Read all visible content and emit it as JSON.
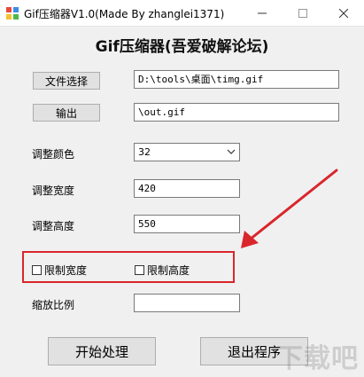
{
  "window": {
    "title": "Gif压缩器V1.0(Made By zhanglei1371)"
  },
  "heading": "Gif压缩器(吾爱破解论坛)",
  "file_select": {
    "button_label": "文件选择",
    "path_value": "D:\\tools\\桌面\\timg.gif"
  },
  "output": {
    "button_label": "输出",
    "value": "\\out.gif"
  },
  "color": {
    "label": "调整颜色",
    "selected": "32"
  },
  "width": {
    "label": "调整宽度",
    "value": "420"
  },
  "height": {
    "label": "调整高度",
    "value": "550"
  },
  "limits": {
    "limit_width_label": "限制宽度",
    "limit_height_label": "限制高度"
  },
  "scale": {
    "label": "缩放比例",
    "value": ""
  },
  "actions": {
    "start_label": "开始处理",
    "exit_label": "退出程序"
  },
  "accent": {
    "annotation": "#d9262b"
  },
  "watermark": "下载吧"
}
